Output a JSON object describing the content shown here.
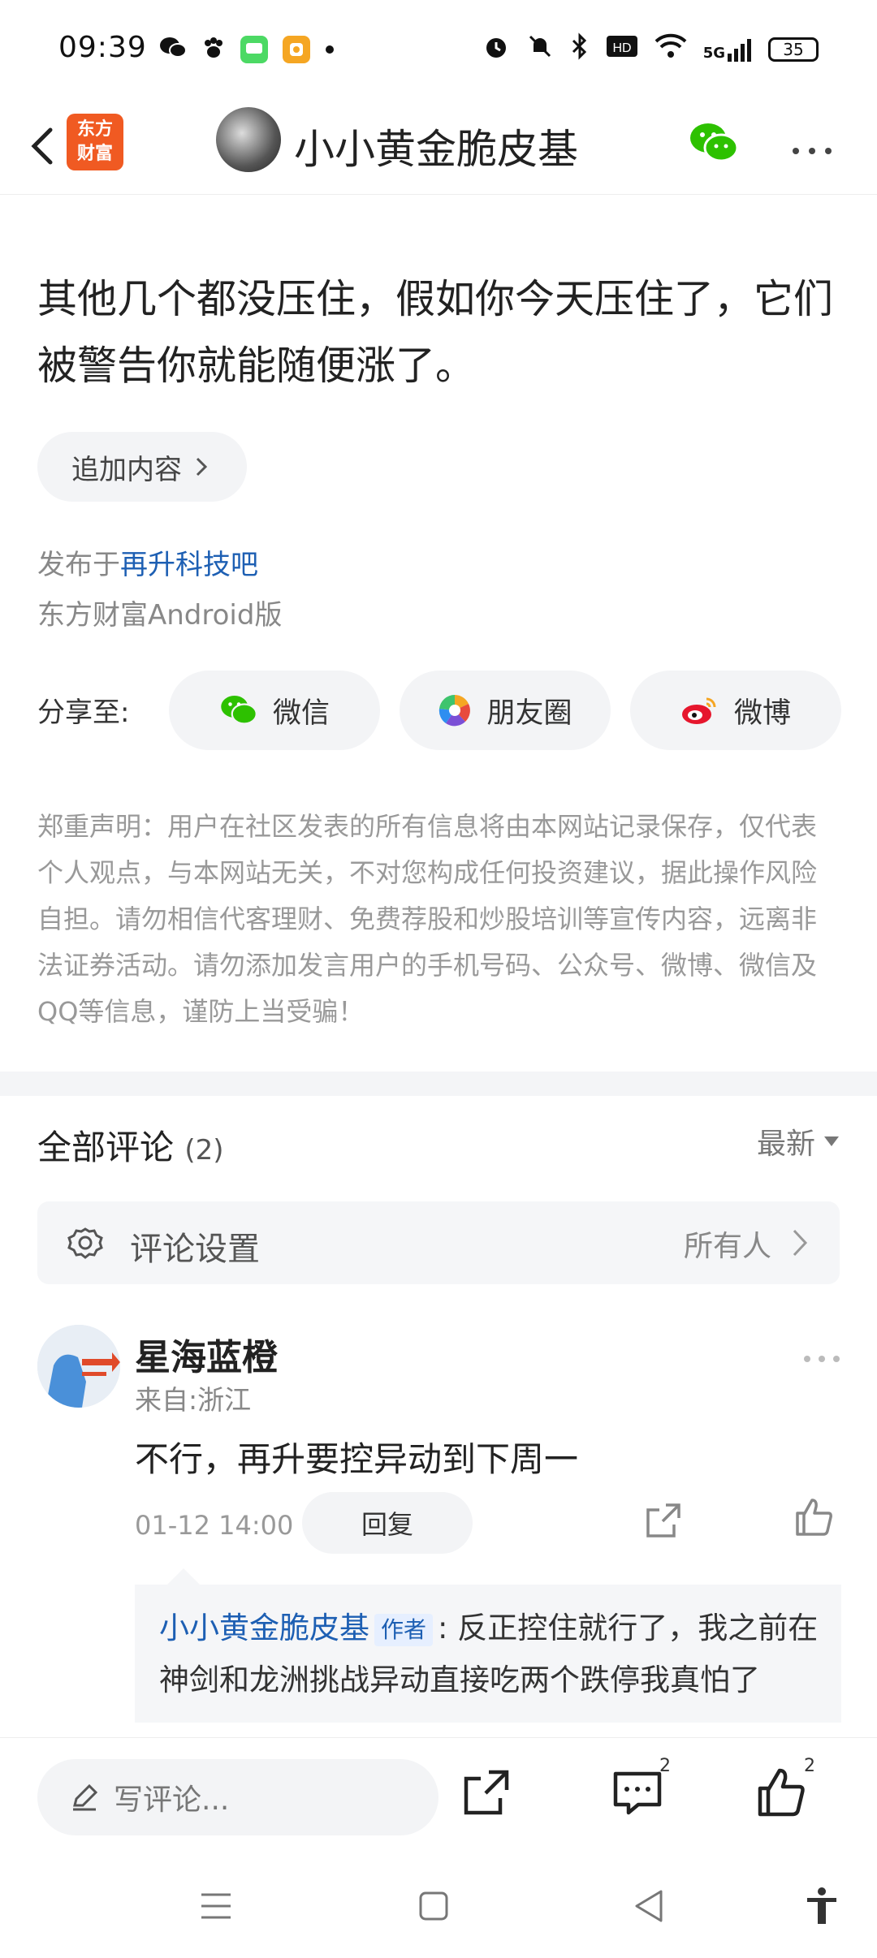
{
  "status_bar": {
    "time": "09:39",
    "battery": "35",
    "network": "5G",
    "left_icons": [
      "wechat-icon",
      "baidu-icon",
      "messages-icon",
      "app-icon",
      "dot-icon"
    ],
    "right_icons": [
      "alarm-icon",
      "mute-icon",
      "bluetooth-icon",
      "hd-icon",
      "wifi-icon",
      "signal-icon",
      "battery-icon"
    ]
  },
  "header": {
    "app_logo_line1": "东方",
    "app_logo_line2": "财富",
    "title": "小小黄金脆皮基"
  },
  "post": {
    "body": "其他几个都没压住，假如你今天压住了，它们被警告你就能随便涨了。",
    "append_label": "追加内容",
    "published_prefix": "发布于",
    "forum": "再升科技吧",
    "client": "东方财富Android版"
  },
  "share": {
    "label": "分享至:",
    "wechat": "微信",
    "moments": "朋友圈",
    "weibo": "微博"
  },
  "disclaimer": "郑重声明：用户在社区发表的所有信息将由本网站记录保存，仅代表个人观点，与本网站无关，不对您构成任何投资建议，据此操作风险自担。请勿相信代客理财、免费荐股和炒股培训等宣传内容，远离非法证券活动。请勿添加发言用户的手机号码、公众号、微博、微信及QQ等信息，谨防上当受骗！",
  "comments": {
    "title": "全部评论",
    "count": "(2)",
    "sort_label": "最新",
    "settings_label": "评论设置",
    "settings_value": "所有人",
    "items": [
      {
        "author": "星海蓝橙",
        "location": "来自:浙江",
        "text": "不行，再升要控异动到下周一",
        "time": "01-12 14:00",
        "reply_label": "回复",
        "reply": {
          "author": "小小黄金脆皮基",
          "tag": "作者",
          "text": ": 反正控住就行了，我之前在神剑和龙洲挑战异动直接吃两个跌停我真怕了"
        }
      }
    ]
  },
  "bottom_bar": {
    "write_placeholder": "写评论...",
    "comment_count": "2",
    "like_count": "2"
  },
  "colors": {
    "link_blue": "#1d5fb3",
    "brand_orange": "#f05a22",
    "wechat_green": "#2dc100",
    "weibo_red": "#e6162d"
  }
}
